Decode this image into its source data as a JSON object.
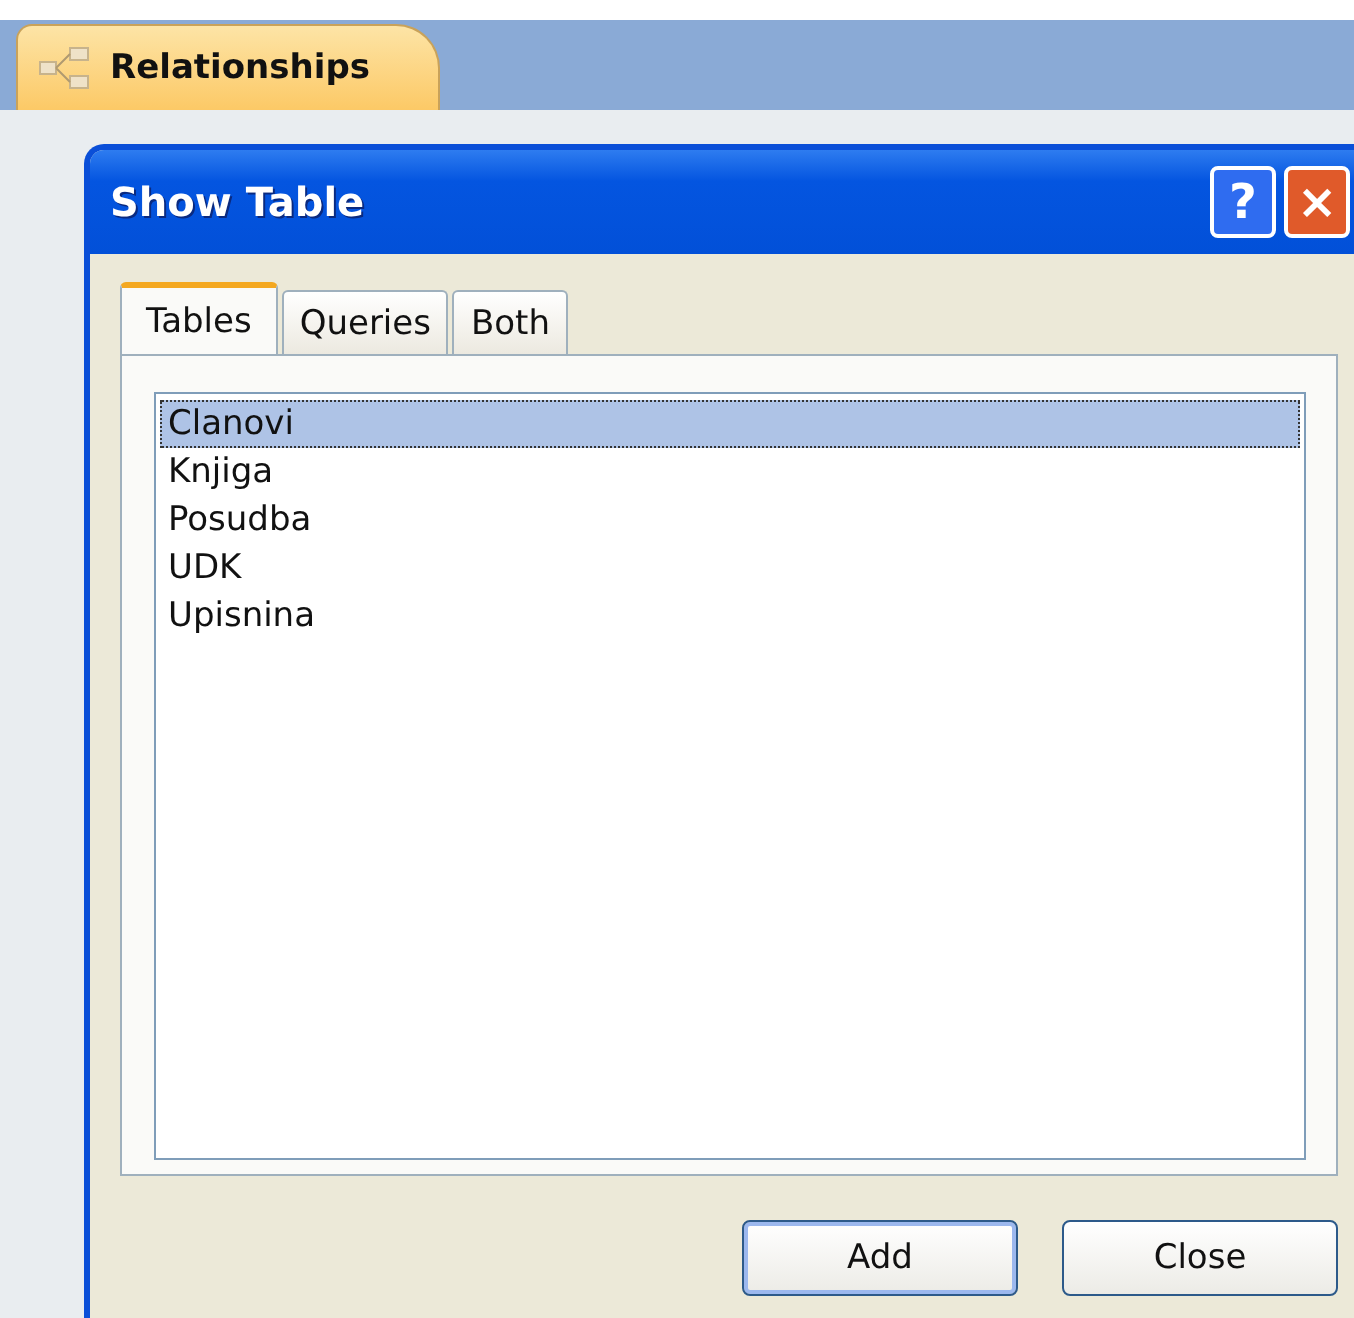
{
  "document_tab": {
    "label": "Relationships"
  },
  "dialog": {
    "title": "Show Table",
    "help_button": "?",
    "close_button": "×"
  },
  "tabs": [
    {
      "label": "Tables",
      "selected": true
    },
    {
      "label": "Queries",
      "selected": false
    },
    {
      "label": "Both",
      "selected": false
    }
  ],
  "list_items": [
    {
      "label": "Clanovi",
      "selected": true
    },
    {
      "label": "Knjiga",
      "selected": false
    },
    {
      "label": "Posudba",
      "selected": false
    },
    {
      "label": "UDK",
      "selected": false
    },
    {
      "label": "Upisnina",
      "selected": false
    }
  ],
  "buttons": [
    {
      "label": "Add",
      "default": true
    },
    {
      "label": "Close",
      "default": false
    }
  ]
}
